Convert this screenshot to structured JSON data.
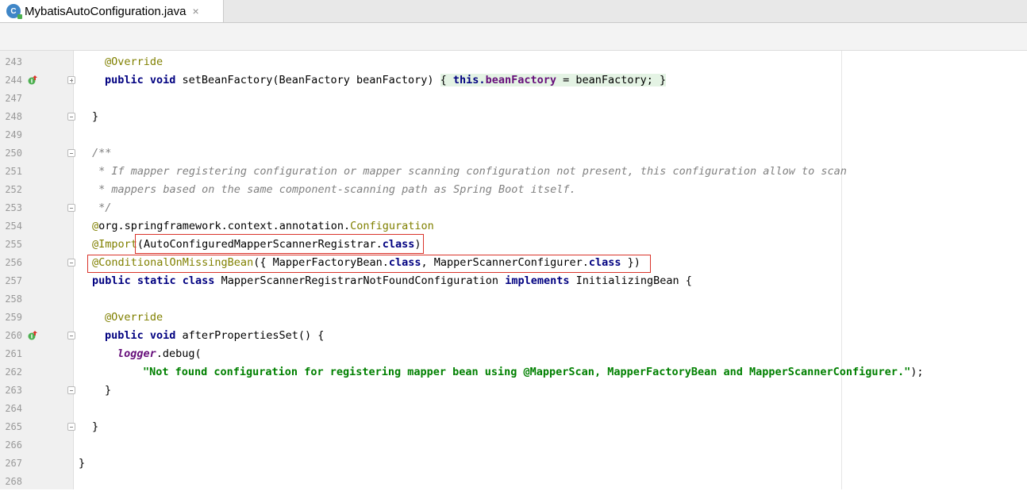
{
  "tab": {
    "icon_label": "C",
    "title": "MybatisAutoConfiguration.java",
    "close": "×"
  },
  "lines": [
    {
      "num": "243"
    },
    {
      "num": "244"
    },
    {
      "num": "247"
    },
    {
      "num": "248"
    },
    {
      "num": "249"
    },
    {
      "num": "250"
    },
    {
      "num": "251"
    },
    {
      "num": "252"
    },
    {
      "num": "253"
    },
    {
      "num": "254"
    },
    {
      "num": "255"
    },
    {
      "num": "256"
    },
    {
      "num": "257"
    },
    {
      "num": "258"
    },
    {
      "num": "259"
    },
    {
      "num": "260"
    },
    {
      "num": "261"
    },
    {
      "num": "262"
    },
    {
      "num": "263"
    },
    {
      "num": "264"
    },
    {
      "num": "265"
    },
    {
      "num": "266"
    },
    {
      "num": "267"
    },
    {
      "num": "268"
    }
  ],
  "code": {
    "l243": {
      "ann": "@Override"
    },
    "l244": {
      "a": "public void ",
      "b": "setBeanFactory(BeanFactory beanFactory) ",
      "c": "{ ",
      "d": "this.",
      "e": "beanFactory",
      " f": "",
      "g": " = beanFactory; ",
      "h": "}"
    },
    "l248": {
      "a": "}"
    },
    "l250": {
      "a": "/**"
    },
    "l251": {
      "a": " * If mapper registering configuration or mapper scanning configuration not present, this configuration allow to scan"
    },
    "l252": {
      "a": " * mappers based on the same component-scanning path as Spring Boot itself."
    },
    "l253": {
      "a": " */"
    },
    "l254": {
      "a": "@",
      "b": "org.springframework.context.annotation.",
      "c": "Configuration"
    },
    "l255": {
      "a": "@Import",
      "b": "(AutoConfiguredMapperScannerRegistrar.",
      "c": "class",
      ")": ")"
    },
    "l256": {
      "a": "@ConditionalOnMissingBean",
      "b": "({ MapperFactoryBean.",
      "c": "class",
      ", ": ", MapperScannerConfigurer.",
      "d": "class",
      " })": " })"
    },
    "l257": {
      "a": "public static class ",
      "b": "MapperScannerRegistrarNotFoundConfiguration ",
      "c": "implements ",
      "d": "InitializingBean {"
    },
    "l259": {
      "ann": "@Override"
    },
    "l260": {
      "a": "public void ",
      "b": "afterPropertiesSet() {"
    },
    "l261": {
      "a": "logger",
      ".debug(": ".debug("
    },
    "l262": {
      "a": "\"Not found configuration for registering mapper bean using @MapperScan, MapperFactoryBean and MapperScannerConfigurer.\"",
      "b": ");"
    },
    "l263": {
      "a": "}"
    },
    "l265": {
      "a": "}"
    },
    "l267": {
      "a": "}"
    }
  },
  "colors": {
    "keyword": "#000080",
    "annotation": "#808000",
    "comment": "#808080",
    "field": "#660e7a",
    "string": "#008000",
    "highlight_box": "#d9342b"
  }
}
